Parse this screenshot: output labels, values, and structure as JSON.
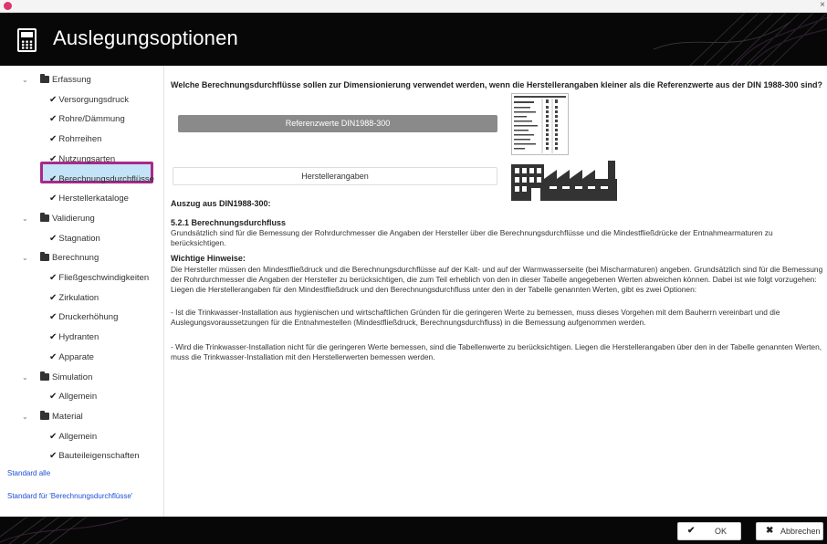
{
  "window": {
    "close_glyph": "×"
  },
  "header": {
    "title": "Auslegungsoptionen",
    "icon": "calculator-icon"
  },
  "sidebar": {
    "groups": [
      {
        "label": "Erfassung",
        "items": [
          "Versorgungsdruck",
          "Rohre/Dämmung",
          "Rohrreihen",
          "Nutzungsarten",
          "Berechnungsdurchflüsse",
          "Herstellerkataloge"
        ]
      },
      {
        "label": "Validierung",
        "items": [
          "Stagnation"
        ]
      },
      {
        "label": "Berechnung",
        "items": [
          "Fließgeschwindigkeiten",
          "Zirkulation",
          "Druckerhöhung",
          "Hydranten",
          "Apparate"
        ]
      },
      {
        "label": "Simulation",
        "items": [
          "Allgemein"
        ]
      },
      {
        "label": "Material",
        "items": [
          "Allgemein",
          "Bauteileigenschaften"
        ]
      }
    ],
    "selected": "Berechnungsdurchflüsse",
    "selected_color": "#a8298a",
    "link_default_all": "Standard alle",
    "link_default_current": "Standard für 'Berechnungsdurchflüsse'"
  },
  "main": {
    "question": "Welche Berechnungsdurchflüsse sollen zur Dimensionierung verwendet werden, wenn die Herstellerangaben kleiner als die Referenzwerte aus der DIN 1988-300 sind?",
    "btn_reference": "Referenzwerte DIN1988-300",
    "btn_manufacturer": "Herstellerangaben",
    "excerpt_title": "Auszug aus DIN1988-300:",
    "section_title": "5.2.1 Berechnungsdurchfluss",
    "section_text": "Grundsätzlich sind für die Bemessung der Rohrdurchmesser die Angaben der Hersteller über die Berechnungsdurchflüsse und die Mindestfließdrücke der Entnahmearmaturen zu berücksichtigen.",
    "hints_title": "Wichtige Hinweise:",
    "hints_text": "Die Hersteller müssen den Mindestfließdruck und die Berechnungsdurchflüsse auf der Kalt- und auf der Warmwasserseite (bei Mischarmaturen) angeben. Grundsätzlich sind für die Bemessung der Rohrdurchmesser die Angaben der Hersteller zu berücksichtigen, die zum Teil erheblich von den in dieser Tabelle angegebenen Werten abweichen können. Dabei ist wie folgt vorzugehen: Liegen die Herstellerangaben für den Mindestfließdruck und den Berechnungsdurchfluss unter den in der Tabelle genannten Werten, gibt es zwei Optionen:",
    "option_1": "- Ist die Trinkwasser-Installation aus hygienischen und wirtschaftlichen Gründen für die geringeren Werte zu bemessen, muss dieses Vorgehen mit dem Bauherrn vereinbart und die Auslegungsvoraussetzungen für die Entnahmestellen (Mindestfließdruck, Berechnungsdurchfluss) in die Bemessung aufgenommen werden.",
    "option_2": "- Wird die Trinkwasser-Installation nicht für die geringeren Werte bemessen, sind die Tabellenwerte zu berücksichtigen. Liegen die Herstellerangaben über den in der Tabelle genannten Werten, muss die Trinkwasser-Installation mit den Herstellerwerten bemessen werden."
  },
  "footer": {
    "ok_label": "OK",
    "cancel_label": "Abbrechen"
  }
}
